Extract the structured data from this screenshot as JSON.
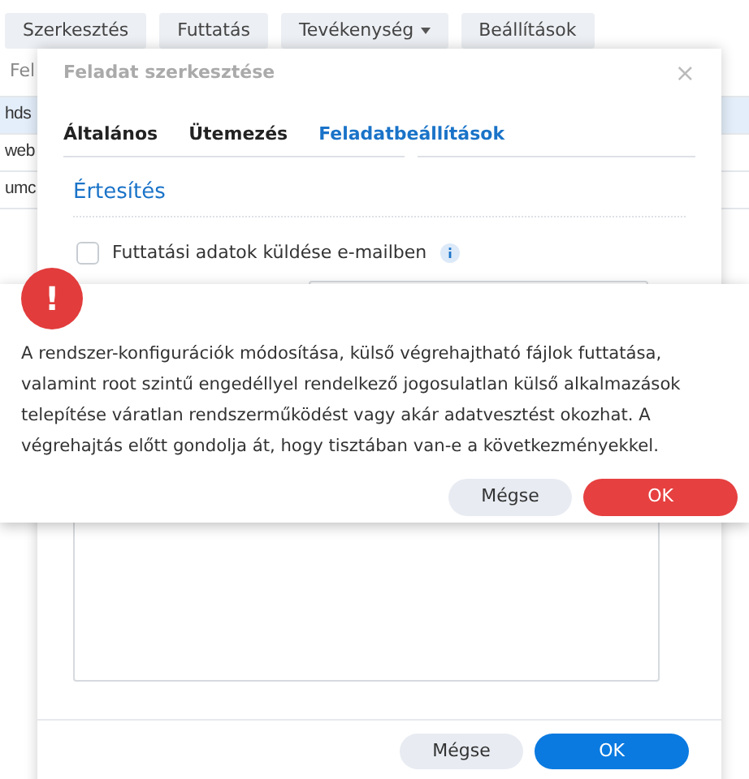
{
  "toolbar": {
    "buttons": [
      {
        "label": "Szerkesztés",
        "kind": "plain"
      },
      {
        "label": "Futtatás",
        "kind": "plain"
      },
      {
        "label": "Tevékenység",
        "kind": "menu"
      },
      {
        "label": "Beállítások",
        "kind": "plain"
      }
    ]
  },
  "table": {
    "header": "Fel",
    "rows": [
      {
        "cell": "hds",
        "selected": true
      },
      {
        "cell": "web",
        "selected": false
      },
      {
        "cell": "umc",
        "selected": false
      }
    ]
  },
  "edit_dialog": {
    "title": "Feladat szerkesztése",
    "close": "×",
    "tabs": [
      {
        "label": "Általános",
        "selected": false
      },
      {
        "label": "Ütemezés",
        "selected": false
      },
      {
        "label": "Feladatbeállítások",
        "selected": true
      }
    ],
    "section": "Értesítés",
    "email_option": {
      "label": "Futtatási adatok küldése e-mailben",
      "checked": false
    },
    "buttons": [
      {
        "label": "Mégse",
        "kind": "secondary"
      },
      {
        "label": "OK",
        "kind": "primary"
      }
    ]
  },
  "alert": {
    "icon": "!",
    "message": "A rendszer-konfigurációk módosítása, külső végrehajtható fájlok futtatása, valamint root szintű engedéllyel rendelkező jogosulatlan külső alkalmazások telepítése váratlan rendszerműködést vagy akár adatvesztést okozhat. A végrehajtás előtt gondolja át, hogy tisztában van-e a következményekkel.",
    "buttons": [
      {
        "label": "Mégse",
        "kind": "secondary"
      },
      {
        "label": "OK",
        "kind": "danger"
      }
    ]
  }
}
